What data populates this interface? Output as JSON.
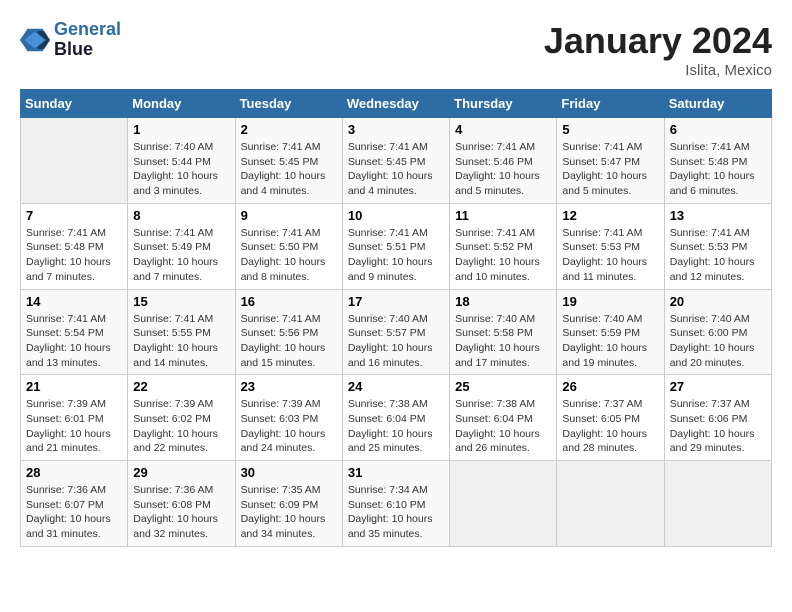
{
  "header": {
    "logo_line1": "General",
    "logo_line2": "Blue",
    "title": "January 2024",
    "subtitle": "Islita, Mexico"
  },
  "days_of_week": [
    "Sunday",
    "Monday",
    "Tuesday",
    "Wednesday",
    "Thursday",
    "Friday",
    "Saturday"
  ],
  "weeks": [
    [
      {
        "day": "",
        "info": ""
      },
      {
        "day": "1",
        "info": "Sunrise: 7:40 AM\nSunset: 5:44 PM\nDaylight: 10 hours\nand 3 minutes."
      },
      {
        "day": "2",
        "info": "Sunrise: 7:41 AM\nSunset: 5:45 PM\nDaylight: 10 hours\nand 4 minutes."
      },
      {
        "day": "3",
        "info": "Sunrise: 7:41 AM\nSunset: 5:45 PM\nDaylight: 10 hours\nand 4 minutes."
      },
      {
        "day": "4",
        "info": "Sunrise: 7:41 AM\nSunset: 5:46 PM\nDaylight: 10 hours\nand 5 minutes."
      },
      {
        "day": "5",
        "info": "Sunrise: 7:41 AM\nSunset: 5:47 PM\nDaylight: 10 hours\nand 5 minutes."
      },
      {
        "day": "6",
        "info": "Sunrise: 7:41 AM\nSunset: 5:48 PM\nDaylight: 10 hours\nand 6 minutes."
      }
    ],
    [
      {
        "day": "7",
        "info": "Sunrise: 7:41 AM\nSunset: 5:48 PM\nDaylight: 10 hours\nand 7 minutes."
      },
      {
        "day": "8",
        "info": "Sunrise: 7:41 AM\nSunset: 5:49 PM\nDaylight: 10 hours\nand 7 minutes."
      },
      {
        "day": "9",
        "info": "Sunrise: 7:41 AM\nSunset: 5:50 PM\nDaylight: 10 hours\nand 8 minutes."
      },
      {
        "day": "10",
        "info": "Sunrise: 7:41 AM\nSunset: 5:51 PM\nDaylight: 10 hours\nand 9 minutes."
      },
      {
        "day": "11",
        "info": "Sunrise: 7:41 AM\nSunset: 5:52 PM\nDaylight: 10 hours\nand 10 minutes."
      },
      {
        "day": "12",
        "info": "Sunrise: 7:41 AM\nSunset: 5:53 PM\nDaylight: 10 hours\nand 11 minutes."
      },
      {
        "day": "13",
        "info": "Sunrise: 7:41 AM\nSunset: 5:53 PM\nDaylight: 10 hours\nand 12 minutes."
      }
    ],
    [
      {
        "day": "14",
        "info": "Sunrise: 7:41 AM\nSunset: 5:54 PM\nDaylight: 10 hours\nand 13 minutes."
      },
      {
        "day": "15",
        "info": "Sunrise: 7:41 AM\nSunset: 5:55 PM\nDaylight: 10 hours\nand 14 minutes."
      },
      {
        "day": "16",
        "info": "Sunrise: 7:41 AM\nSunset: 5:56 PM\nDaylight: 10 hours\nand 15 minutes."
      },
      {
        "day": "17",
        "info": "Sunrise: 7:40 AM\nSunset: 5:57 PM\nDaylight: 10 hours\nand 16 minutes."
      },
      {
        "day": "18",
        "info": "Sunrise: 7:40 AM\nSunset: 5:58 PM\nDaylight: 10 hours\nand 17 minutes."
      },
      {
        "day": "19",
        "info": "Sunrise: 7:40 AM\nSunset: 5:59 PM\nDaylight: 10 hours\nand 19 minutes."
      },
      {
        "day": "20",
        "info": "Sunrise: 7:40 AM\nSunset: 6:00 PM\nDaylight: 10 hours\nand 20 minutes."
      }
    ],
    [
      {
        "day": "21",
        "info": "Sunrise: 7:39 AM\nSunset: 6:01 PM\nDaylight: 10 hours\nand 21 minutes."
      },
      {
        "day": "22",
        "info": "Sunrise: 7:39 AM\nSunset: 6:02 PM\nDaylight: 10 hours\nand 22 minutes."
      },
      {
        "day": "23",
        "info": "Sunrise: 7:39 AM\nSunset: 6:03 PM\nDaylight: 10 hours\nand 24 minutes."
      },
      {
        "day": "24",
        "info": "Sunrise: 7:38 AM\nSunset: 6:04 PM\nDaylight: 10 hours\nand 25 minutes."
      },
      {
        "day": "25",
        "info": "Sunrise: 7:38 AM\nSunset: 6:04 PM\nDaylight: 10 hours\nand 26 minutes."
      },
      {
        "day": "26",
        "info": "Sunrise: 7:37 AM\nSunset: 6:05 PM\nDaylight: 10 hours\nand 28 minutes."
      },
      {
        "day": "27",
        "info": "Sunrise: 7:37 AM\nSunset: 6:06 PM\nDaylight: 10 hours\nand 29 minutes."
      }
    ],
    [
      {
        "day": "28",
        "info": "Sunrise: 7:36 AM\nSunset: 6:07 PM\nDaylight: 10 hours\nand 31 minutes."
      },
      {
        "day": "29",
        "info": "Sunrise: 7:36 AM\nSunset: 6:08 PM\nDaylight: 10 hours\nand 32 minutes."
      },
      {
        "day": "30",
        "info": "Sunrise: 7:35 AM\nSunset: 6:09 PM\nDaylight: 10 hours\nand 34 minutes."
      },
      {
        "day": "31",
        "info": "Sunrise: 7:34 AM\nSunset: 6:10 PM\nDaylight: 10 hours\nand 35 minutes."
      },
      {
        "day": "",
        "info": ""
      },
      {
        "day": "",
        "info": ""
      },
      {
        "day": "",
        "info": ""
      }
    ]
  ]
}
